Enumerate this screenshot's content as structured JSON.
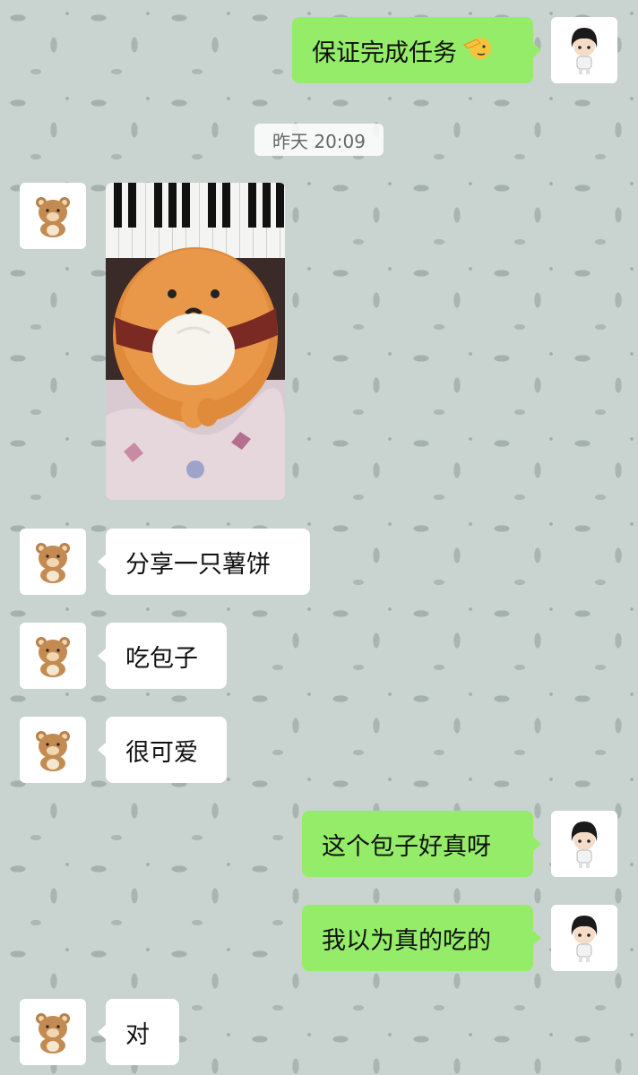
{
  "messages": {
    "m1": "保证完成任务",
    "m3": "分享一只薯饼",
    "m4": "吃包子",
    "m5": "很可爱",
    "m6": "这个包子好真呀",
    "m7": "我以为真的吃的",
    "m8": "对"
  },
  "timestamp": "昨天 20:09",
  "icons": {
    "salute": "salute-emoji",
    "bear": "bear-avatar",
    "boy": "boy-avatar"
  },
  "colors": {
    "outgoing_bubble": "#95ec69",
    "incoming_bubble": "#ffffff",
    "background": "#c9d3d0"
  }
}
